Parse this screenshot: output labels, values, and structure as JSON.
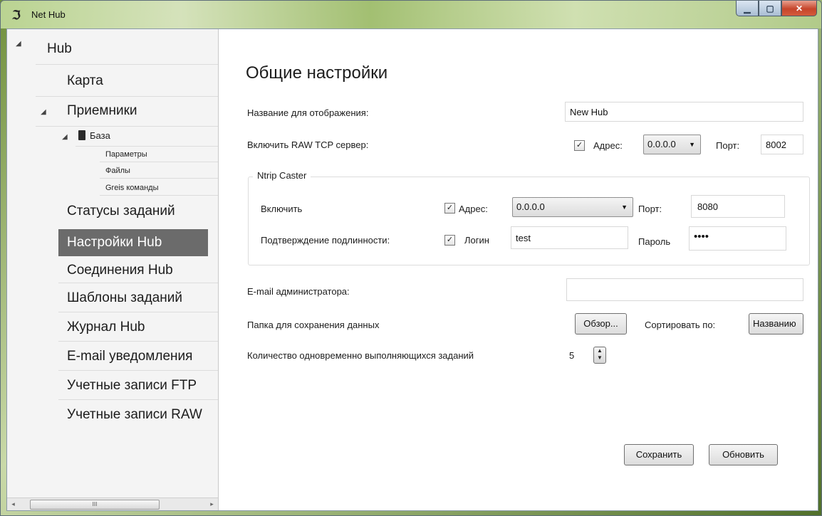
{
  "window": {
    "title": "Net Hub",
    "icon": "net-hub-logo-icon"
  },
  "sidebar": {
    "root": "Hub",
    "items": {
      "map": "Карта",
      "receivers": "Приемники",
      "base": "База",
      "params": "Параметры",
      "files": "Файлы",
      "greis": "Greis команды",
      "task_status": "Статусы заданий",
      "hub_settings": "Настройки Hub",
      "hub_connections": "Соединения Hub",
      "task_templates": "Шаблоны заданий",
      "hub_log": "Журнал Hub",
      "email_notify": "E-mail уведомления",
      "ftp_accounts": "Учетные записи FTP",
      "raw_accounts": "Учетные записи RAW"
    },
    "selected": "hub_settings",
    "scroll_glyph": "III"
  },
  "main": {
    "title": "Общие настройки",
    "display_name": {
      "label": "Название для отображения:",
      "value": "New Hub"
    },
    "raw_tcp": {
      "label": "Включить RAW TCP сервер:",
      "checked": true,
      "address_label": "Адрес:",
      "address_value": "0.0.0.0",
      "port_label": "Порт:",
      "port_value": "8002"
    },
    "ntrip": {
      "legend": "Ntrip Caster",
      "enable_label": "Включить",
      "enable_checked": true,
      "address_label": "Адрес:",
      "address_value": "0.0.0.0",
      "port_label": "Порт:",
      "port_value": "8080",
      "auth_label": "Подтверждение подлинности:",
      "auth_checked": true,
      "login_label": "Логин",
      "login_value": "test",
      "password_label": "Пароль",
      "password_value": "••••"
    },
    "admin_email": {
      "label": "E-mail администратора:",
      "value": ""
    },
    "data_folder": {
      "label": "Папка для сохранения данных",
      "browse": "Обзор...",
      "sort_label": "Сортировать по:",
      "sort_value": "Названию"
    },
    "concurrent_tasks": {
      "label": "Количество одновременно выполняющихся заданий",
      "value": "5"
    },
    "buttons": {
      "save": "Сохранить",
      "refresh": "Обновить"
    }
  },
  "glyphs": {
    "check": "✓",
    "combo_arrow": "▼",
    "tree_expanded": "◢",
    "scroll_left": "◂",
    "scroll_right": "▸",
    "spin_up": "▲",
    "spin_down": "▼"
  }
}
